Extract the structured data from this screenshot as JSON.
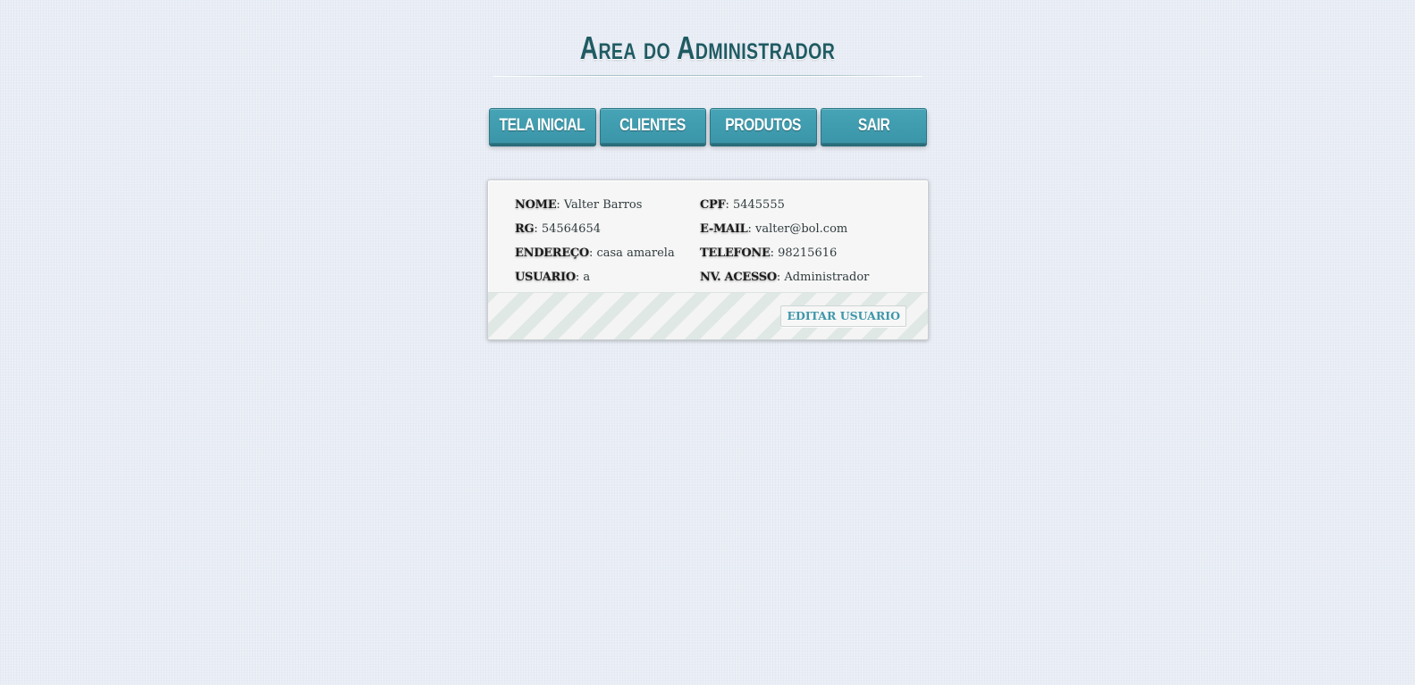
{
  "header": {
    "title": "Area do Administrador"
  },
  "nav": {
    "items": [
      {
        "label": "TELA INICIAL"
      },
      {
        "label": "CLIENTES"
      },
      {
        "label": "PRODUTOS"
      },
      {
        "label": "SAIR"
      }
    ]
  },
  "user": {
    "nome": {
      "label": "NOME",
      "value": "Valter Barros"
    },
    "cpf": {
      "label": "CPF",
      "value": "5445555"
    },
    "rg": {
      "label": "RG",
      "value": "54564654"
    },
    "email": {
      "label": "E-MAIL",
      "value": "valter@bol.com"
    },
    "endereco": {
      "label": "ENDEREÇO",
      "value": "casa amarela"
    },
    "telefone": {
      "label": "TELEFONE",
      "value": "98215616"
    },
    "usuario": {
      "label": "USUARIO",
      "value": "a"
    },
    "nivel_acesso": {
      "label": "NV. ACESSO",
      "value": "Administrador"
    }
  },
  "actions": {
    "edit_label": "EDITAR USUARIO"
  },
  "colors": {
    "background": "#e9edf5",
    "title": "#1f5b63",
    "nav_button": "#3e9aae",
    "edit_text": "#3e97aa"
  }
}
